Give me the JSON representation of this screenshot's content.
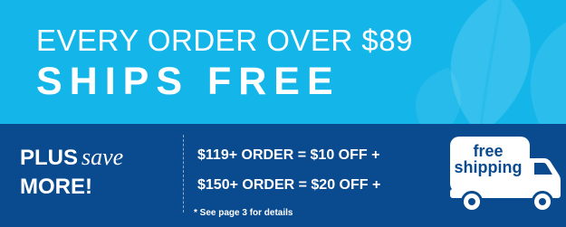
{
  "headline": {
    "line1": "EVERY ORDER OVER $89",
    "line2": "SHIPS FREE"
  },
  "promo": {
    "plus": "PLUS",
    "save": "save",
    "more": "MORE!",
    "offers": [
      "$119+ ORDER = $10 OFF +",
      "$150+ ORDER = $20 OFF +"
    ],
    "note": "* See page 3 for details"
  },
  "badge": {
    "line1": "free",
    "line2": "shipping",
    "icon": "truck-icon"
  },
  "colors": {
    "top_background": "#14b6ea",
    "bottom_background": "#0a4a8e",
    "text": "#ffffff"
  }
}
